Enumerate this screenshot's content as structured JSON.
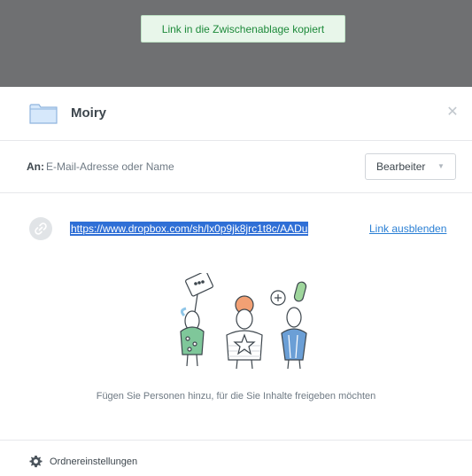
{
  "toast": {
    "message": "Link in die Zwischenablage kopiert"
  },
  "header": {
    "folder_name": "Moiry",
    "close_glyph": "✕"
  },
  "recipient": {
    "to_label": "An:",
    "placeholder": "E-Mail-Adresse oder Name",
    "value": "",
    "role": "Bearbeiter",
    "role_chevron": "▼"
  },
  "link": {
    "url": "https://www.dropbox.com/sh/lx0p9jk8jrc1t8c/AADu",
    "hide_label": "Link ausblenden"
  },
  "empty_state": {
    "text": "Fügen Sie Personen hinzu, für die Sie Inhalte freigeben möchten"
  },
  "footer": {
    "settings_label": "Ordnereinstellungen"
  },
  "icons": {
    "folder": "folder-icon",
    "close": "close-icon",
    "link": "link-icon",
    "gear": "gear-icon",
    "chevron": "chevron-down-icon"
  },
  "colors": {
    "overlay": "#6f7072",
    "toast_bg": "#e8f6ea",
    "toast_text": "#1d8a3a",
    "link_highlight": "#2f6fd6",
    "link_text": "#2a7fd4"
  }
}
